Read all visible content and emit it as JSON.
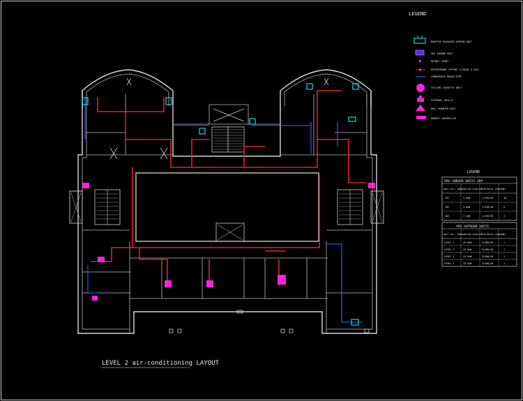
{
  "drawing": {
    "title": "LEVEL 2 air-conditioning LAYOUT",
    "colors": {
      "background": "#000000",
      "walls": "#d8d8d8",
      "refrigerant_pipe": "#e0242a",
      "drain_pipe": "#2f6bff",
      "indoor_unit": "#ff22dd",
      "outdoor_unit": "#1ed6e0"
    }
  },
  "legend": {
    "title": "LEGEND",
    "items": [
      {
        "icon": "outdoor-unit-icon",
        "label": "ROOFTOP PACKAGED AIRCON UNIT"
      },
      {
        "icon": "indoor-unit-icon",
        "label": "VRV INDOOR UNIT"
      },
      {
        "icon": "refnet-joint-icon",
        "label": "REFNET JOINT"
      },
      {
        "icon": "refrigerant-pipe-icon",
        "label": "REFRIGERANT PIPING (LIQUID & GAS)"
      },
      {
        "icon": "drain-pipe-icon",
        "label": "CONDENSATE DRAIN PIPE"
      },
      {
        "icon": "ceiling-cassette-icon",
        "label": "CEILING CASSETTE UNIT"
      },
      {
        "icon": "exhaust-grille-icon",
        "label": "EXTERNAL GRILLE"
      },
      {
        "icon": "wall-mounted-icon",
        "label": "WALL MOUNTED UNIT"
      },
      {
        "icon": "remote-control-icon",
        "label": "REMOTE CONTROLLER"
      }
    ]
  },
  "schedule": {
    "title": "LEGEND",
    "indoor": {
      "title": "VRV INDOOR UNITS VRV",
      "headers": [
        "UNIT TAG / MODEL",
        "COOLING CAPACITY",
        "ELECTRICAL CHARACT.",
        "QTY"
      ],
      "rows": [
        [
          "IN1",
          "2.8kW",
          "1/230/50",
          "18"
        ],
        [
          "IN2",
          "3.6kW",
          "1/230/50",
          "6"
        ],
        [
          "IN3",
          "7.1kW",
          "1/230/50",
          "4"
        ]
      ]
    },
    "outdoor": {
      "title": "VRV OUTDOOR UNITS",
      "headers": [
        "UNIT TAG / MODEL",
        "COOLING CAPACITY",
        "ELECTRICAL CHARACT.",
        "QTY"
      ],
      "rows": [
        [
          "LEVEL 1",
          "45.0kW",
          "3/400/50",
          "1"
        ],
        [
          "LEVEL 2",
          "45.0kW",
          "3/400/50",
          "1"
        ],
        [
          "LEVEL 3",
          "33.5kW",
          "3/400/50",
          "1"
        ],
        [
          "LEVEL 4",
          "33.5kW",
          "3/400/50",
          "1"
        ]
      ]
    }
  }
}
